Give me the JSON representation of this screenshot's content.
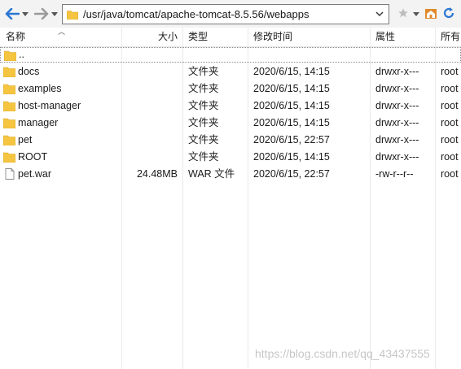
{
  "toolbar": {
    "path": "/usr/java/tomcat/apache-tomcat-8.5.56/webapps",
    "icons": [
      "back-arrow-icon",
      "back-dropdown-icon",
      "forward-arrow-icon",
      "forward-dropdown-icon",
      "folder-icon",
      "chevron-down-icon",
      "star-icon",
      "home-icon",
      "refresh-icon"
    ]
  },
  "columns": {
    "name": "名称",
    "size": "大小",
    "type": "类型",
    "modified": "修改时间",
    "permissions": "属性",
    "owner": "所有"
  },
  "parent": {
    "name": ".."
  },
  "files": [
    {
      "name": "docs",
      "size": "",
      "type": "文件夹",
      "modified": "2020/6/15, 14:15",
      "permissions": "drwxr-x---",
      "owner": "root",
      "icon": "folder-icon"
    },
    {
      "name": "examples",
      "size": "",
      "type": "文件夹",
      "modified": "2020/6/15, 14:15",
      "permissions": "drwxr-x---",
      "owner": "root",
      "icon": "folder-icon"
    },
    {
      "name": "host-manager",
      "size": "",
      "type": "文件夹",
      "modified": "2020/6/15, 14:15",
      "permissions": "drwxr-x---",
      "owner": "root",
      "icon": "folder-icon"
    },
    {
      "name": "manager",
      "size": "",
      "type": "文件夹",
      "modified": "2020/6/15, 14:15",
      "permissions": "drwxr-x---",
      "owner": "root",
      "icon": "folder-icon"
    },
    {
      "name": "pet",
      "size": "",
      "type": "文件夹",
      "modified": "2020/6/15, 22:57",
      "permissions": "drwxr-x---",
      "owner": "root",
      "icon": "folder-icon"
    },
    {
      "name": "ROOT",
      "size": "",
      "type": "文件夹",
      "modified": "2020/6/15, 14:15",
      "permissions": "drwxr-x---",
      "owner": "root",
      "icon": "folder-icon"
    },
    {
      "name": "pet.war",
      "size": "24.48MB",
      "type": "WAR 文件",
      "modified": "2020/6/15, 22:57",
      "permissions": "-rw-r--r--",
      "owner": "root",
      "icon": "file-icon"
    }
  ],
  "watermark": "https://blog.csdn.net/qq_43437555",
  "colors": {
    "folder": "#f5c542",
    "nav_arrow": "#2b78d4",
    "home": "#e08a2c",
    "refresh": "#2b78d4"
  }
}
